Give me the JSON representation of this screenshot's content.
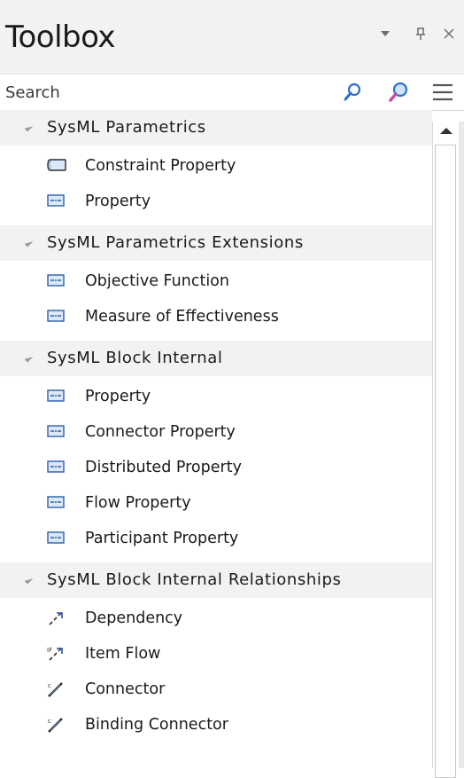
{
  "titlebar": {
    "title": "Toolbox",
    "dropdown_glyph": "▾",
    "pin_glyph": "ᵖ",
    "close_glyph": "×"
  },
  "search": {
    "placeholder": "Search",
    "value": ""
  },
  "icons": {
    "search_small": "magnifier-icon",
    "search_large": "magnifier-colored-icon",
    "menu": "hamburger-menu-icon"
  },
  "groups": [
    {
      "title": "SysML Parametrics",
      "items": [
        {
          "label": "Constraint Property",
          "icon": "constraint-property-icon"
        },
        {
          "label": "Property",
          "icon": "property-icon"
        }
      ]
    },
    {
      "title": "SysML Parametrics Extensions",
      "items": [
        {
          "label": "Objective Function",
          "icon": "property-icon"
        },
        {
          "label": "Measure of Effectiveness",
          "icon": "property-icon"
        }
      ]
    },
    {
      "title": "SysML Block Internal",
      "items": [
        {
          "label": "Property",
          "icon": "property-icon"
        },
        {
          "label": "Connector Property",
          "icon": "property-icon"
        },
        {
          "label": "Distributed Property",
          "icon": "property-icon"
        },
        {
          "label": "Flow Property",
          "icon": "property-icon"
        },
        {
          "label": "Participant Property",
          "icon": "property-icon"
        }
      ]
    },
    {
      "title": "SysML Block Internal Relationships",
      "items": [
        {
          "label": "Dependency",
          "icon": "dependency-icon"
        },
        {
          "label": "Item Flow",
          "icon": "item-flow-icon"
        },
        {
          "label": "Connector",
          "icon": "connector-icon"
        },
        {
          "label": "Binding Connector",
          "icon": "binding-connector-icon"
        }
      ]
    }
  ],
  "colors": {
    "property_icon_fill": "#dbe8f7",
    "property_icon_border": "#2e5fa8",
    "arrow_blue": "#1f4fa3"
  }
}
